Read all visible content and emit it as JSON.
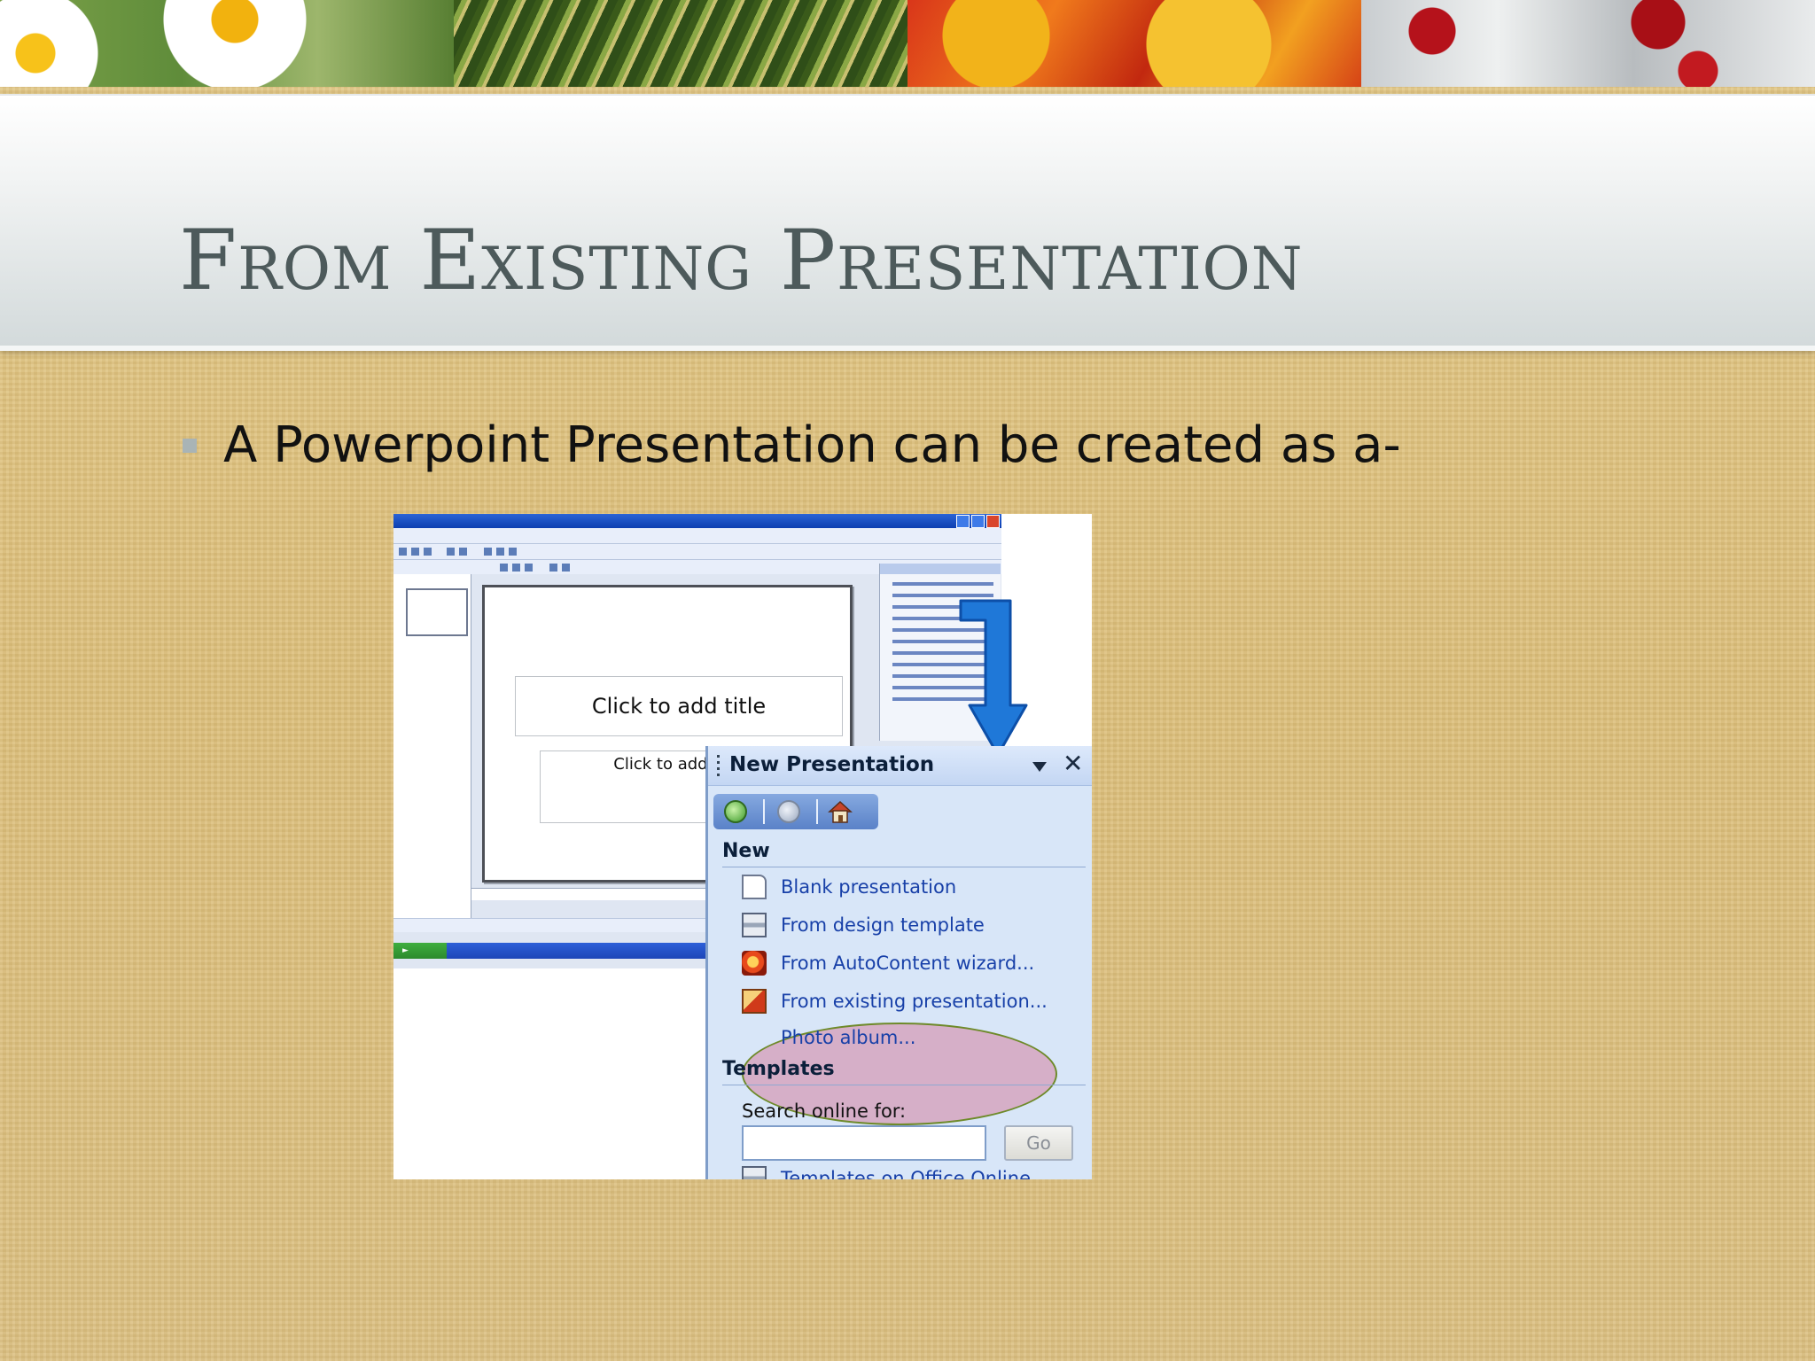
{
  "slide": {
    "title": "From Existing Presentation",
    "bullet": "A Powerpoint Presentation can be created as a-"
  },
  "screenshot": {
    "placeholders": {
      "title": "Click to add title",
      "subtitle": "Click to add s"
    },
    "task_pane": {
      "title": "New Presentation",
      "section_new": "New",
      "items": [
        {
          "label": "Blank presentation",
          "icon": "blank-document-icon"
        },
        {
          "label": "From design template",
          "icon": "design-template-icon"
        },
        {
          "label": "From AutoContent wizard...",
          "icon": "autocontent-wizard-icon"
        },
        {
          "label": "From existing presentation...",
          "icon": "existing-presentation-icon"
        },
        {
          "label": "Photo album..."
        }
      ],
      "section_templates": "Templates",
      "search_label": "Search online for:",
      "search_value": "",
      "go_label": "Go",
      "cut_off_item": "Templates on Office Online"
    }
  }
}
